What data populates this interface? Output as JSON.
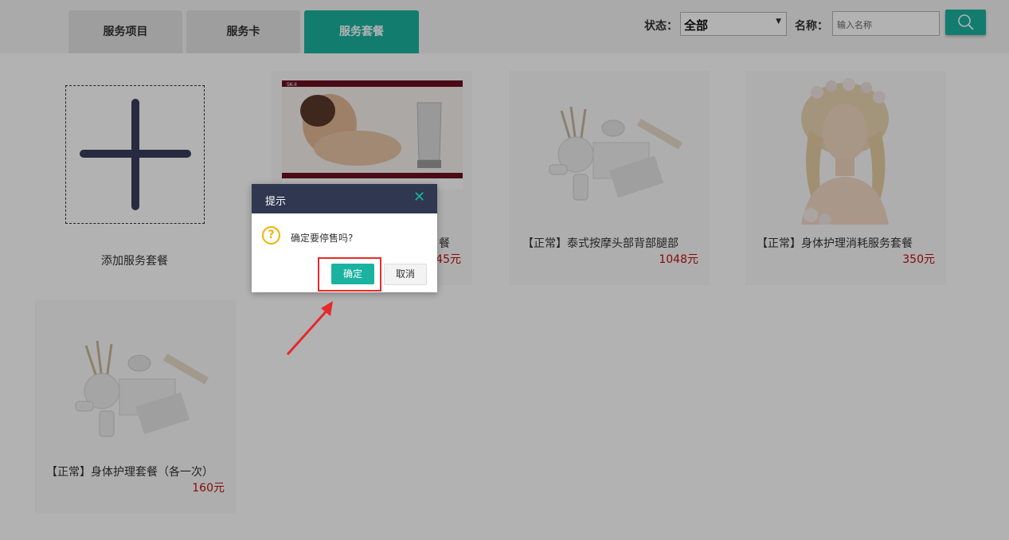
{
  "tabs": [
    {
      "label": "服务项目"
    },
    {
      "label": "服务卡"
    },
    {
      "label": "服务套餐",
      "active": true
    }
  ],
  "filters": {
    "status_label": "状态：",
    "status_value": "全部",
    "name_label": "名称：",
    "name_placeholder": "输入名称"
  },
  "add": {
    "label": "添加服务套餐"
  },
  "cards": [
    {
      "title": "【正常】泰式按摩头部背部腿部",
      "price": "1048元",
      "image": "cosmetics-still-life"
    },
    {
      "title": "【正常】身体护理消耗服务套餐",
      "price": "350元",
      "image": "woman-flower-crown-portrait"
    },
    {
      "title": "【正常】身体护理套餐（各一次）",
      "price": "160元",
      "image": "cosmetics-still-life"
    },
    {
      "title": "",
      "price": "45元",
      "image": "skii-face-wash-banner",
      "partial_title": "餐"
    }
  ],
  "dialog": {
    "title": "提示",
    "message": "确定要停售吗?",
    "confirm": "确定",
    "cancel": "取消"
  },
  "colors": {
    "accent": "#1bb2a0",
    "dialog_header": "#2f3850",
    "price": "#c01010",
    "annotation": "#e62a2a"
  }
}
